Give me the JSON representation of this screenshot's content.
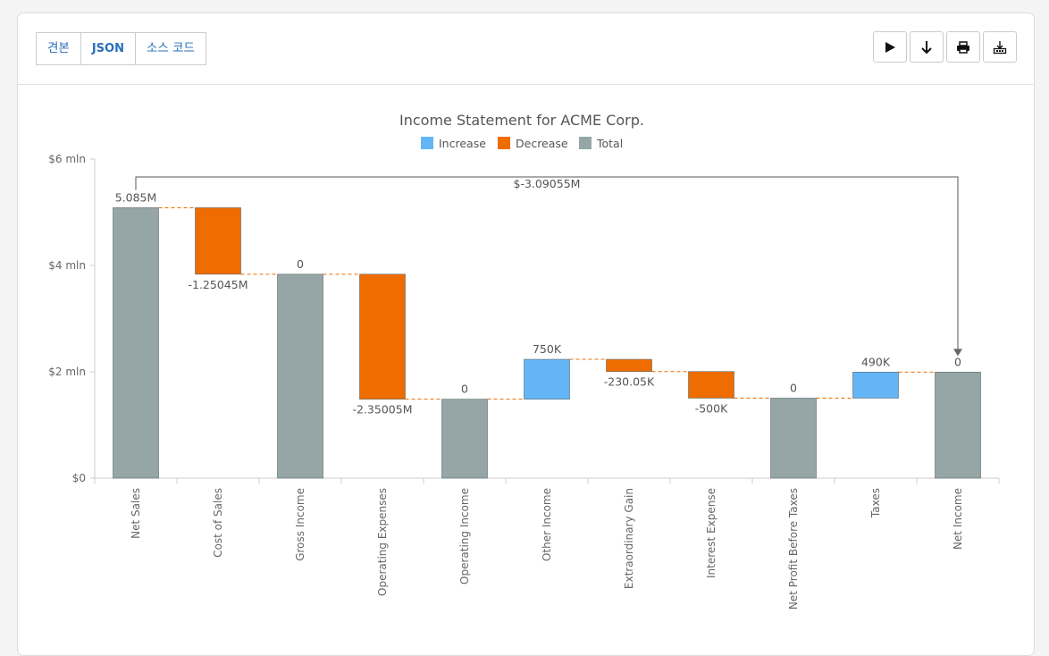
{
  "tabs": [
    {
      "label": "견본"
    },
    {
      "label": "JSON"
    },
    {
      "label": "소스 코드"
    }
  ],
  "toolbar_buttons": [
    "play-icon",
    "download-arrow-icon",
    "print-icon",
    "export-icon"
  ],
  "chart_data": {
    "type": "waterfall",
    "title": "Income Statement for ACME Corp.",
    "legend": [
      {
        "label": "Increase",
        "color": "#64b5f6"
      },
      {
        "label": "Decrease",
        "color": "#ef6c00"
      },
      {
        "label": "Total",
        "color": "#96a6a6"
      }
    ],
    "legend_position": "top-center",
    "y_ticks": [
      "$0",
      "$2 mln",
      "$4 mln",
      "$6 mln"
    ],
    "ylim": [
      0,
      6000000
    ],
    "categories": [
      "Net Sales",
      "Cost of Sales",
      "Gross Income",
      "Operating Expenses",
      "Operating Income",
      "Other Income",
      "Extraordinary Gain",
      "Interest Expense",
      "Net Profit Before Taxes",
      "Taxes",
      "Net Income"
    ],
    "bars": [
      {
        "kind": "total",
        "start": 0,
        "end": 5085000,
        "label": "5.085M",
        "label_pos": "top"
      },
      {
        "kind": "decrease",
        "start": 5085000,
        "end": 3834550,
        "label": "-1.25045M",
        "label_pos": "bottom"
      },
      {
        "kind": "total",
        "start": 0,
        "end": 3834550,
        "label": "0",
        "label_pos": "top"
      },
      {
        "kind": "decrease",
        "start": 3834550,
        "end": 1484500,
        "label": "-2.35005M",
        "label_pos": "bottom"
      },
      {
        "kind": "total",
        "start": 0,
        "end": 1484500,
        "label": "0",
        "label_pos": "top"
      },
      {
        "kind": "increase",
        "start": 1484500,
        "end": 2234500,
        "label": "750K",
        "label_pos": "top"
      },
      {
        "kind": "decrease",
        "start": 2234500,
        "end": 2004450,
        "label": "-230.05K",
        "label_pos": "bottom"
      },
      {
        "kind": "decrease",
        "start": 2004450,
        "end": 1504450,
        "label": "-500K",
        "label_pos": "bottom"
      },
      {
        "kind": "total",
        "start": 0,
        "end": 1504450,
        "label": "0",
        "label_pos": "top"
      },
      {
        "kind": "increase",
        "start": 1504450,
        "end": 1994450,
        "label": "490K",
        "label_pos": "top"
      },
      {
        "kind": "total",
        "start": 0,
        "end": 1994450,
        "label": "0",
        "label_pos": "top"
      }
    ],
    "connector_color": "#ef6c00",
    "annotation": {
      "label": "$-3.09055M",
      "from": "Net Sales",
      "to": "Net Income"
    }
  }
}
